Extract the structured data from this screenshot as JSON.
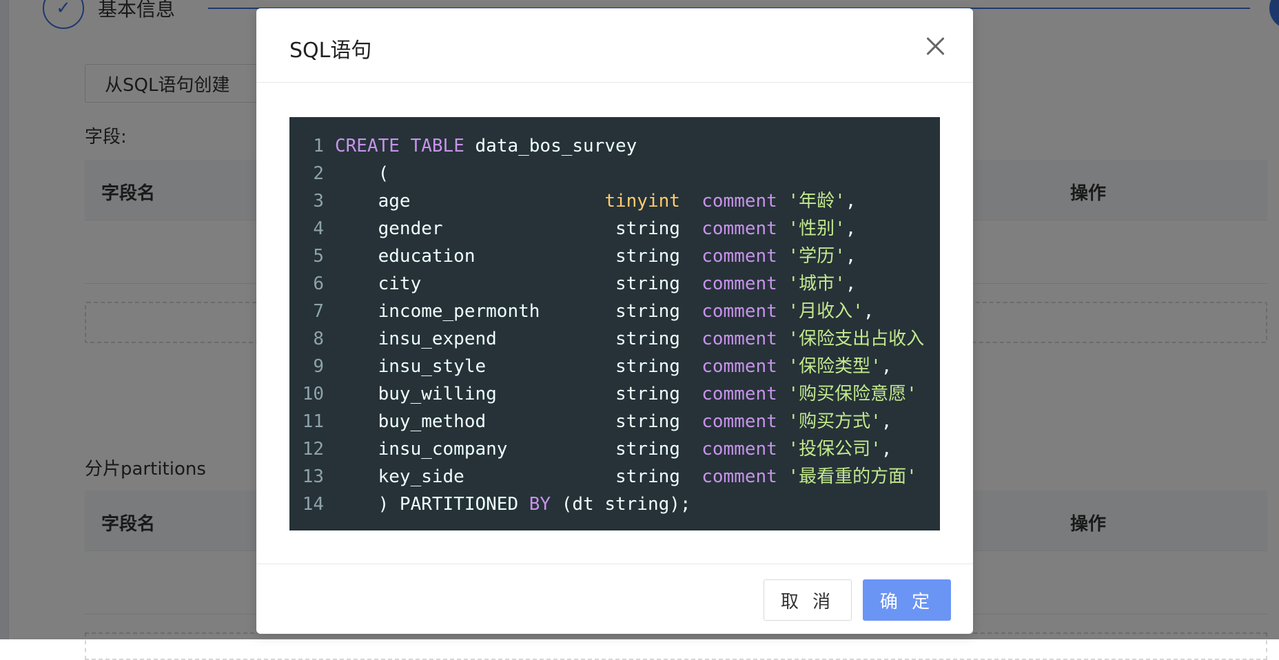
{
  "background": {
    "step_title": "基本信息",
    "create_from_sql_button": "从SQL语句创建",
    "fields_label": "字段:",
    "partitions_label": "分片partitions",
    "table_headers": {
      "field_name": "字段名",
      "action": "操作"
    }
  },
  "modal": {
    "title": "SQL语句",
    "cancel_label": "取 消",
    "ok_label": "确 定",
    "code_lines": [
      {
        "n": "1",
        "html": "<span class=\"kw\">CREATE</span> <span class=\"kw\">TABLE</span> data_bos_survey"
      },
      {
        "n": "2",
        "html": "    ("
      },
      {
        "n": "3",
        "html": "    age                  <span class=\"ty\">tinyint</span>  <span class=\"kw\">comment</span> <span class=\"st\">'年龄'</span>,"
      },
      {
        "n": "4",
        "html": "    gender                string  <span class=\"kw\">comment</span> <span class=\"st\">'性别'</span>,"
      },
      {
        "n": "5",
        "html": "    education             string  <span class=\"kw\">comment</span> <span class=\"st\">'学历'</span>,"
      },
      {
        "n": "6",
        "html": "    city                  string  <span class=\"kw\">comment</span> <span class=\"st\">'城市'</span>,"
      },
      {
        "n": "7",
        "html": "    income_permonth       string  <span class=\"kw\">comment</span> <span class=\"st\">'月收入'</span>,"
      },
      {
        "n": "8",
        "html": "    insu_expend           string  <span class=\"kw\">comment</span> <span class=\"st\">'保险支出占收入</span>"
      },
      {
        "n": "9",
        "html": "    insu_style            string  <span class=\"kw\">comment</span> <span class=\"st\">'保险类型'</span>,"
      },
      {
        "n": "10",
        "html": "    buy_willing           string  <span class=\"kw\">comment</span> <span class=\"st\">'购买保险意愿'</span>"
      },
      {
        "n": "11",
        "html": "    buy_method            string  <span class=\"kw\">comment</span> <span class=\"st\">'购买方式'</span>,"
      },
      {
        "n": "12",
        "html": "    insu_company          string  <span class=\"kw\">comment</span> <span class=\"st\">'投保公司'</span>,"
      },
      {
        "n": "13",
        "html": "    key_side              string  <span class=\"kw\">comment</span> <span class=\"st\">'最看重的方面'</span>"
      },
      {
        "n": "14",
        "html": "    ) PARTITIONED <span class=\"kw\">BY</span> (dt string);"
      }
    ]
  },
  "colors": {
    "editor_bg": "#263238",
    "keyword": "#c792ea",
    "type": "#ffcb6b",
    "string": "#c3e88d",
    "primary_button": "#6b95f5"
  }
}
